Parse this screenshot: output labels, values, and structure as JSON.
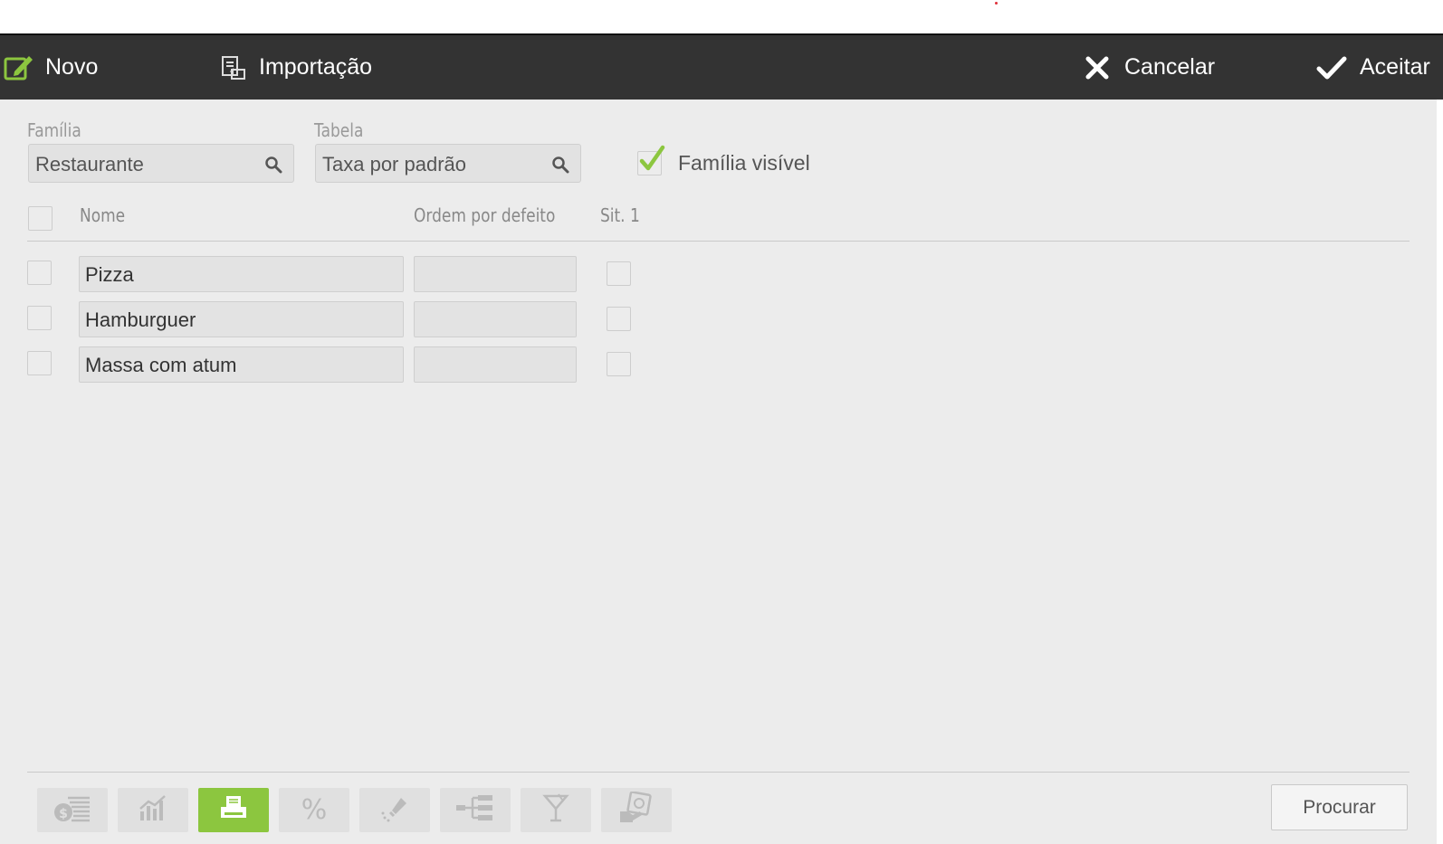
{
  "toolbar": {
    "new_label": "Novo",
    "import_label": "Importação",
    "cancel_label": "Cancelar",
    "accept_label": "Aceitar"
  },
  "filters": {
    "family_label": "Família",
    "family_value": "Restaurante",
    "table_label": "Tabela",
    "table_value": "Taxa por padrão",
    "visible_label": "Família visível",
    "visible_checked": true
  },
  "table": {
    "columns": [
      "Nome",
      "Ordem por defeito",
      "Sit. 1"
    ],
    "rows": [
      {
        "name": "Pizza",
        "order": "",
        "sit1": false
      },
      {
        "name": "Hamburguer",
        "order": "",
        "sit1": false
      },
      {
        "name": "Massa com atum",
        "order": "",
        "sit1": false
      }
    ]
  },
  "bottom_bar": {
    "icons": [
      "price-list-icon",
      "statistics-icon",
      "printer-icon",
      "percent-icon",
      "seasoning-icon",
      "hierarchy-icon",
      "cocktail-icon",
      "coupon-icon"
    ],
    "percent_text": "%",
    "active_icon": "printer-icon",
    "search_label": "Procurar"
  },
  "colors": {
    "toolbar_bg": "#333333",
    "accent_green": "#8cc63f",
    "page_bg": "#ececec"
  }
}
